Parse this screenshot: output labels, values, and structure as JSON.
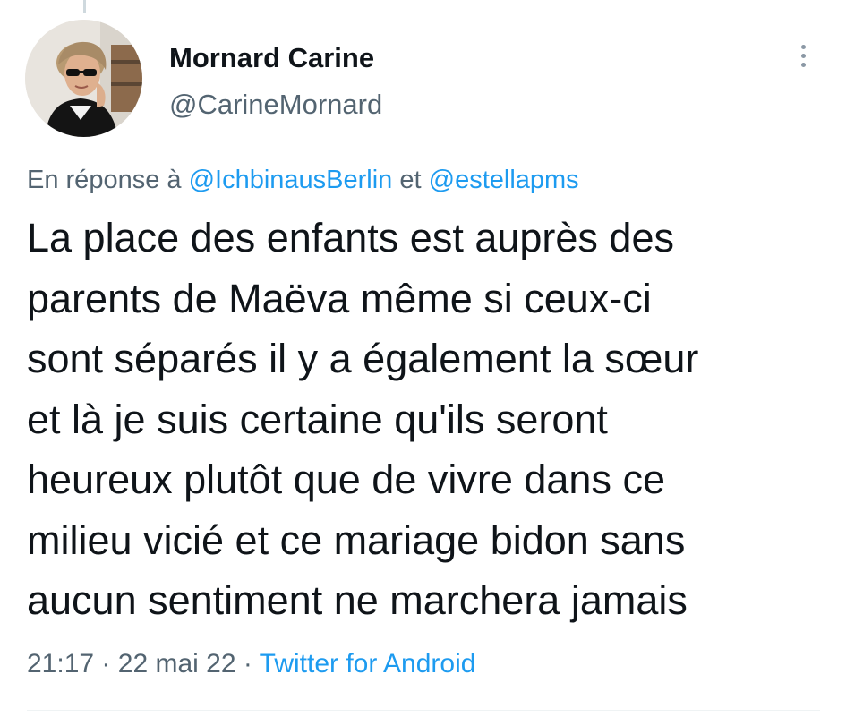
{
  "author": {
    "display_name": "Mornard Carine",
    "handle": "@CarineMornard",
    "avatar_icon": "profile-photo"
  },
  "menu": {
    "icon": "more-vertical-icon"
  },
  "reply": {
    "prefix": "En réponse à",
    "mention_1": "@IchbinausBerlin",
    "separator": "et",
    "mention_2": "@estellapms"
  },
  "tweet": {
    "lines": [
      "La place des enfants est auprès des",
      "parents de Maëva même si ceux-ci",
      "sont séparés il y a également la sœur",
      "et là je suis certaine qu'ils seront",
      "heureux plutôt que de vivre dans ce",
      "milieu vicié et ce mariage bidon sans",
      "aucun sentiment ne marchera jamais"
    ]
  },
  "meta": {
    "time": "21:17",
    "dot": "·",
    "date": "22 mai 22",
    "source": "Twitter for Android"
  },
  "colors": {
    "text": "#0f1419",
    "secondary": "#536471",
    "link": "#1d9bf0"
  }
}
